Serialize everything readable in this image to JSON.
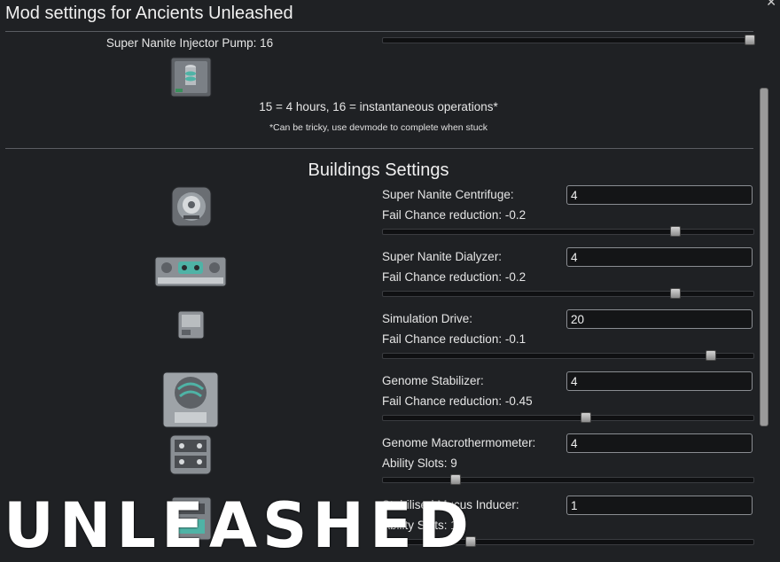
{
  "window": {
    "title": "Mod settings for Ancients Unleashed"
  },
  "pump": {
    "label": "Super Nanite Injector Pump: 16",
    "slider_value": 16,
    "slider_max": 16
  },
  "notes": {
    "main": "15 = 4 hours, 16 = instantaneous operations*",
    "sub": "*Can be tricky, use devmode to complete when stuck"
  },
  "section": {
    "title": "Buildings Settings"
  },
  "buildings": [
    {
      "label": "Super Nanite Centrifuge:",
      "value": "4",
      "sub": "Fail Chance reduction: -0.2",
      "slider_fraction": 0.79
    },
    {
      "label": "Super Nanite Dialyzer:",
      "value": "4",
      "sub": "Fail Chance reduction: -0.2",
      "slider_fraction": 0.79
    },
    {
      "label": "Simulation Drive:",
      "value": "20",
      "sub": "Fail Chance reduction: -0.1",
      "slider_fraction": 0.885
    },
    {
      "label": "Genome Stabilizer:",
      "value": "4",
      "sub": "Fail Chance reduction: -0.45",
      "slider_fraction": 0.547
    },
    {
      "label": "Genome Macrothermometer:",
      "value": "4",
      "sub": "Ability Slots: 9",
      "slider_fraction": 0.197
    },
    {
      "label": "Stabilised Mucus Inducer:",
      "value": "1",
      "sub": "Ability Slots: 11",
      "slider_fraction": 0.237
    }
  ],
  "watermark": "UNLEASHED",
  "colors": {
    "background": "#1f2124",
    "text": "#e6e6e6",
    "input_border": "#8a8d92",
    "accent_teal": "#4fb3a6"
  }
}
